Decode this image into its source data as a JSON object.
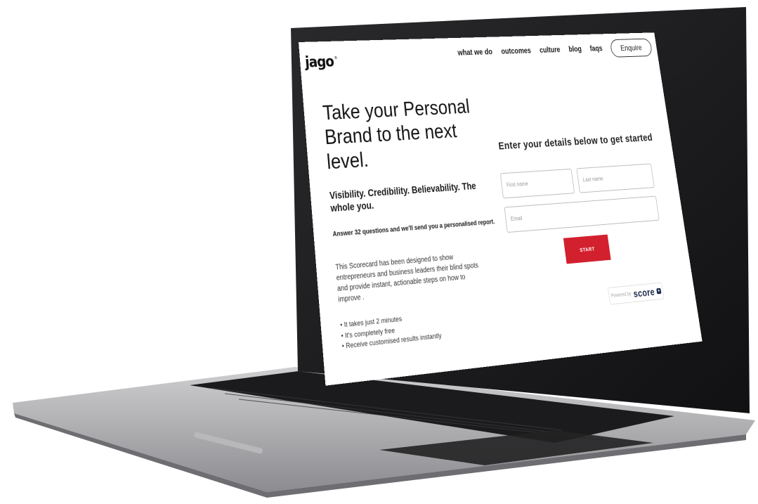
{
  "header": {
    "logo_text": "jago",
    "logo_mark": "®",
    "nav": [
      {
        "label": "what we do"
      },
      {
        "label": "outcomes"
      },
      {
        "label": "culture"
      },
      {
        "label": "blog"
      },
      {
        "label": "faqs"
      }
    ],
    "enquire_label": "Enquire"
  },
  "hero": {
    "title": "Take your Personal Brand to the next level.",
    "subtitle": "Visibility. Credibility. Believability. The whole you.",
    "lead": "Answer 32 questions and we'll send you a personalised report.",
    "description": "This Scorecard has been designed to show entrepreneurs and business leaders their blind spots and provide instant, actionable steps on how to improve .",
    "bullets": [
      "It takes just 2 minutes",
      "It's completely free",
      "Receive customised results instantly"
    ]
  },
  "form": {
    "title": "Enter your details below to get started",
    "first_name_placeholder": "First name",
    "last_name_placeholder": "Last name",
    "email_placeholder": "Email",
    "start_label": "START"
  },
  "powered_by": {
    "label": "Powered by",
    "brand": "score",
    "badge": "●"
  },
  "colors": {
    "accent": "#d3202f",
    "brand_navy": "#1c2a4a",
    "text": "#161616"
  }
}
